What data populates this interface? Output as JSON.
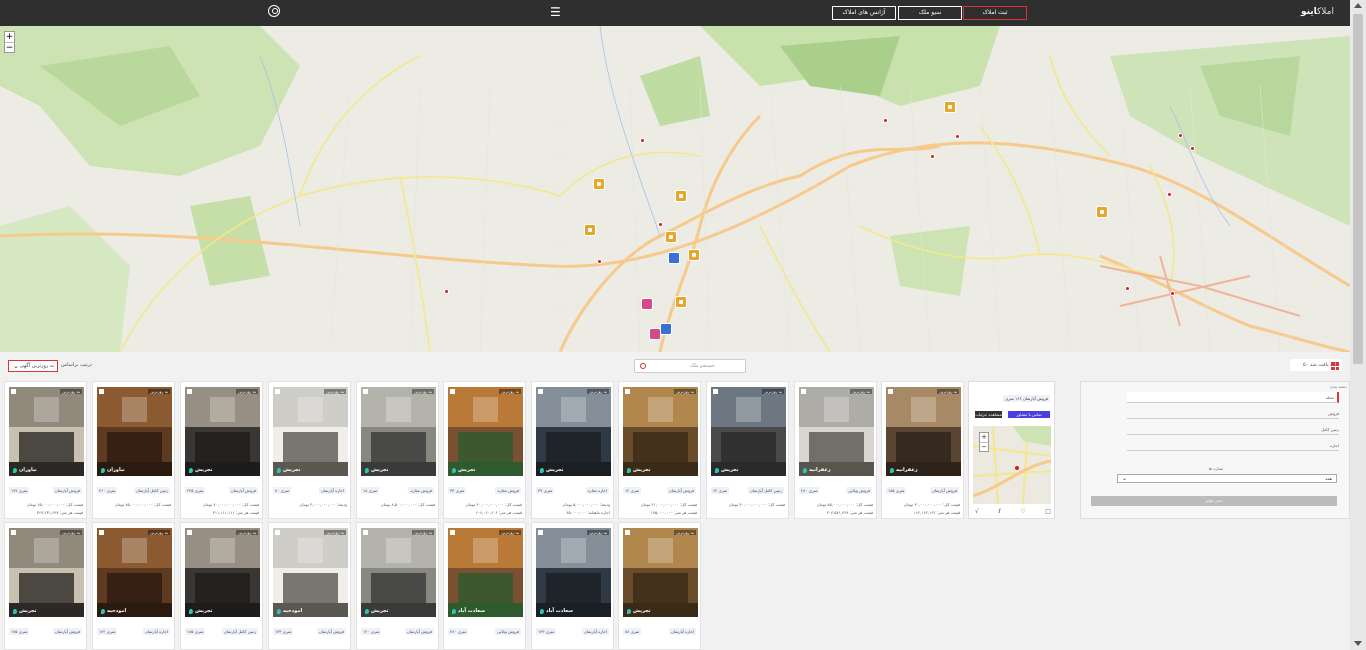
{
  "header": {
    "logo_main": "اینو",
    "logo_prefix": "املاک",
    "btn_register": "ثبت املاک",
    "btn_saved": "سیو ملک",
    "btn_agencies": "آژانس های املاک"
  },
  "map": {
    "zoom_in": "+",
    "zoom_out": "−"
  },
  "toolbar": {
    "sort_label": "ترتیب براساس",
    "sort_value": "به روزترین آگهی",
    "search_placeholder": "جستجو ملک",
    "result_count": "۵۰ ملک یافت شد"
  },
  "filter": {
    "title": "دسته بندی",
    "fields": [
      "محله",
      "فروش",
      "زمین کامل",
      "اجاره"
    ],
    "subtitle": "ستاره ها",
    "select_value": "همه",
    "reset": "حذف فیلتر"
  },
  "featured": {
    "tag": "فروش آپارتمان ۱۶۶ متری",
    "btn_details": "مشاهده جزئیات",
    "btn_contact": "تماس با مشاور"
  },
  "cards_row1": [
    {
      "loc": "زعفرانیه",
      "t1": "فروش آپارتمان",
      "t2": "۱۸۵ متری",
      "p1": "قیمت کل: ۳۰,۰۰۰,۰۰۰,۰۰۰ تومان",
      "p2": "قیمت هر متر: ۱۶۲,۱۶۲,۱۶۲"
    },
    {
      "loc": "زعفرانیه",
      "t1": "فروش ویلایی",
      "t2": "۲۸۰ متری",
      "p1": "قیمت کل: ۸۵,۰۰۰,۰۰۰,۰۰۰ تومان",
      "p2": "قیمت هر متر: ۳۰۳,۵۷۱,۴۲۸"
    },
    {
      "loc": "تجریش",
      "t1": "زمین کامل آپارتمان",
      "t2": "۶۲ متری",
      "p1": "قیمت کل: ۳۰,۰۰۰,۰۰۰,۰۰۰ تومان",
      "p2": ""
    },
    {
      "loc": "تجریش",
      "t1": "فروش آپارتمان",
      "t2": "۱۲ متری",
      "p1": "قیمت کل: ۲۱,۰۰۰,۰۰۰,۰۰۰ تومان",
      "p2": "قیمت هر متر: ۱۷۵,۰۰۰,۰۰۰"
    },
    {
      "loc": "تجریش",
      "t1": "اجاره مغازه",
      "t2": "۳۷ متری",
      "p1": "ودیعه: ۵,۰۰۰,۰۰۰,۰۰۰ تومان",
      "p2": "اجاره ماهیانه: ۴۵,۰۰۰,۰۰۰"
    },
    {
      "loc": "تجریش",
      "t1": "فروش مغازه",
      "t2": "۳۳ متری",
      "p1": "قیمت کل: ۲۰,۰۰۰,۰۰۰,۰۰۰ تومان",
      "p2": "قیمت هر متر: ۶۰۶,۰۶۰,۶۰۶"
    },
    {
      "loc": "تجریش",
      "t1": "فروش مغازه",
      "t2": "۱۸ متری",
      "p1": "قیمت کل: ۸,۵۰۰,۰۰۰,۰۰۰ تومان",
      "p2": ""
    },
    {
      "loc": "تجریش",
      "t1": "اجاره آپارتمان",
      "t2": "۸۰ متری",
      "p1": "ودیعه: ۳,۰۰۰,۰۰۰,۰۰۰ تومان",
      "p2": ""
    },
    {
      "loc": "تجریش",
      "t1": "فروش آپارتمان",
      "t2": "۲۲۵ متری",
      "p1": "قیمت کل: ۷۰,۰۰۰,۰۰۰,۰۰۰ تومان",
      "p2": "قیمت هر متر: ۳۱۱,۱۱۱,۱۱۱"
    },
    {
      "loc": "نیاوران",
      "t1": "زمین کامل آپارتمان",
      "t2": "۲۶۰ متری",
      "p1": "قیمت کل: ۸۵,۰۰۰,۰۰۰,۰۰۰ تومان",
      "p2": ""
    },
    {
      "loc": "نیاوران",
      "t1": "فروش آپارتمان",
      "t2": "۱۷۷ متری",
      "p1": "قیمت کل: ۶۵,۰۰۰,۰۰۰,۰۰۰ تومان",
      "p2": "قیمت هر متر: ۳۶۷,۲۳۱,۶۳۸"
    }
  ],
  "cards_row2": [
    {
      "loc": "تجریش",
      "t1": "اجاره آپارتمان",
      "t2": "۸۸ متری"
    },
    {
      "loc": "سعادت آباد",
      "t1": "اجاره آپارتمان",
      "t2": "۱۴۳ متری"
    },
    {
      "loc": "سعادت آباد",
      "t1": "فروش ویلایی",
      "t2": "۴۸۰ متری"
    },
    {
      "loc": "تجریش",
      "t1": "فروش آپارتمان",
      "t2": "۱۲۰ متری"
    },
    {
      "loc": "امودخیه",
      "t1": "فروش آپارتمان",
      "t2": "۱۳۳ متری"
    },
    {
      "loc": "تجریش",
      "t1": "زمین کامل آپارتمان",
      "t2": "۱۸۵ متری"
    },
    {
      "loc": "امودخیه",
      "t1": "اجاره آپارتمان",
      "t2": "۱۴۲ متری"
    },
    {
      "loc": "تجریش",
      "t1": "فروش آپارتمان",
      "t2": "۱۷۵ متری"
    }
  ],
  "card_badge": "به روزترین"
}
